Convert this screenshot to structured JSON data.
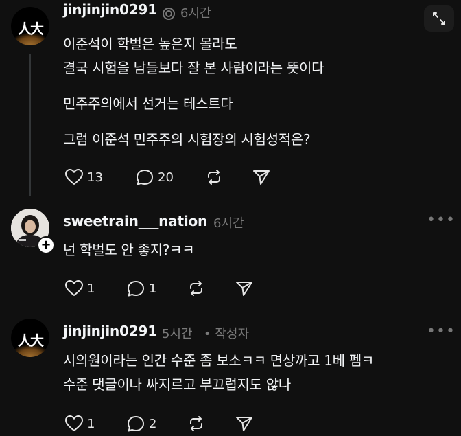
{
  "posts": [
    {
      "username": "jinjinjin0291",
      "time": "6시간",
      "body": [
        "이준석이 학벌은 높은지 몰라도",
        "결국 시험을 남들보다 잘 본 사람이라는 뜻이다",
        "민주주의에서 선거는 테스트다",
        "그럼 이준석 민주주의 시험장의 시험성적은?"
      ],
      "likes": "13",
      "replies": "20"
    },
    {
      "username": "sweetrain___nation",
      "time": "6시간",
      "body": [
        "넌 학벌도 안 좋지?ㅋㅋ"
      ],
      "likes": "1",
      "replies": "1"
    },
    {
      "username": "jinjinjin0291",
      "time": "5시간",
      "author_tag": "• 작성자",
      "body": [
        "시의원이라는 인간 수준 좀 보소ㅋㅋ 면상까고 1베 펨ㅋ",
        "수준 댓글이나 싸지르고 부끄럽지도 않나"
      ],
      "likes": "1",
      "replies": "2"
    }
  ],
  "avatar_mark": "人大",
  "more_label": "•••",
  "follow_label": "+",
  "icons": {
    "like": "heart-icon",
    "reply": "comment-icon",
    "repost": "repost-icon",
    "share": "send-icon",
    "expand": "expand-icon",
    "activity": "activity-ring-icon"
  },
  "colors": {
    "background": "#101010",
    "text": "#f3f5f7",
    "meta": "#7a7a7a",
    "thread_line": "#333638"
  }
}
